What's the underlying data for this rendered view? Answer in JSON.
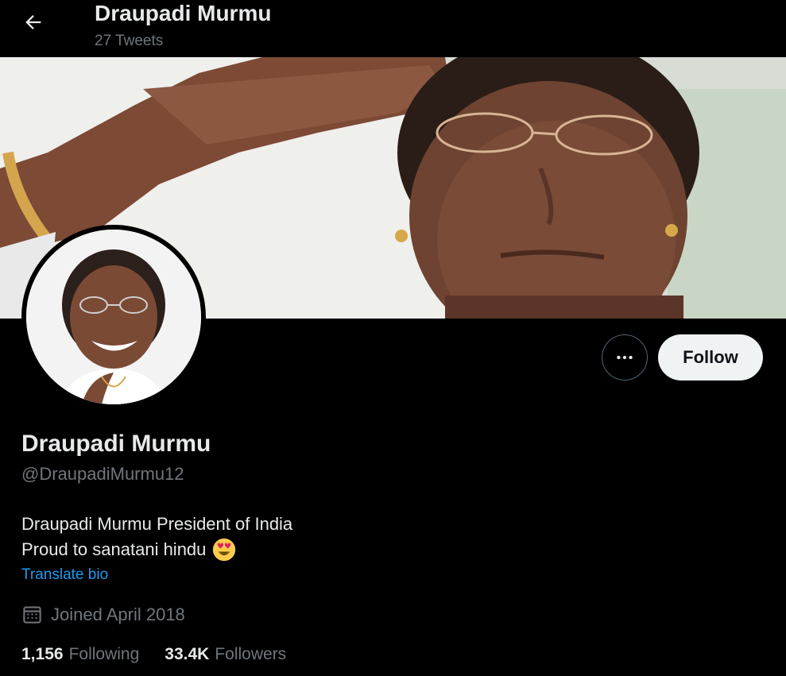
{
  "header": {
    "back_icon": "arrow-left-icon",
    "title": "Draupadi Murmu",
    "tweet_count": "27 Tweets"
  },
  "banner": {
    "description_icon": "banner-photo"
  },
  "actions": {
    "more_icon": "more-horizontal-icon",
    "follow_label": "Follow"
  },
  "profile": {
    "name": "Draupadi Murmu",
    "handle": "@DraupadiMurmu12",
    "bio_line1": "Draupadi Murmu President of India",
    "bio_line2": "Proud to sanatani hindu",
    "bio_emoji": "heart-eyes-emoji",
    "translate_label": "Translate bio",
    "joined_icon": "calendar-icon",
    "joined": "Joined April 2018"
  },
  "stats": {
    "following_count": "1,156",
    "following_label": "Following",
    "followers_count": "33.4K",
    "followers_label": "Followers"
  },
  "colors": {
    "background": "#000000",
    "primary_text": "#e7e9ea",
    "secondary_text": "#71767b",
    "link": "#1d9bf0",
    "follow_button_bg": "#eff3f4"
  }
}
